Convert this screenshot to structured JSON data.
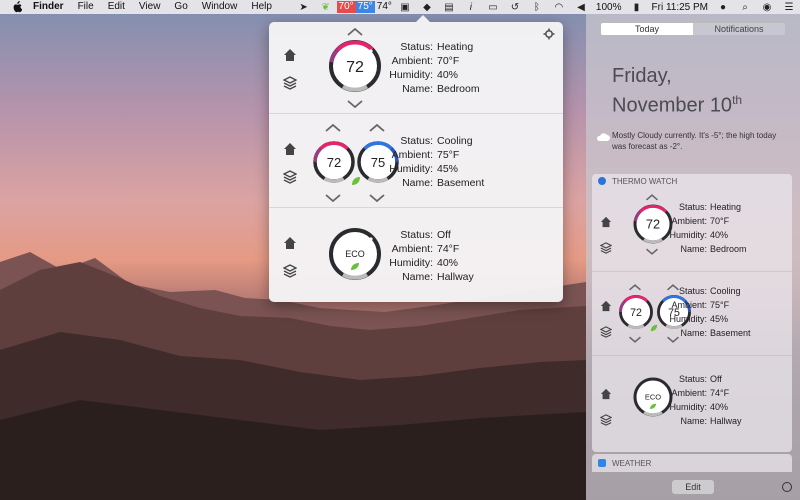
{
  "menubar": {
    "app": "Finder",
    "menus": [
      "File",
      "Edit",
      "View",
      "Go",
      "Window",
      "Help"
    ],
    "temps": [
      "70°",
      "75°",
      "74°"
    ],
    "battery": "100%",
    "clock": "Fri 11:25 PM"
  },
  "popover": {
    "rows": [
      {
        "dials": [
          "72"
        ],
        "status": "Heating",
        "ambient": "70°F",
        "humidity": "40%",
        "name": "Bedroom"
      },
      {
        "dials": [
          "72",
          "75"
        ],
        "status": "Cooling",
        "ambient": "75°F",
        "humidity": "45%",
        "name": "Basement"
      },
      {
        "dials": [
          "ECO"
        ],
        "status": "Off",
        "ambient": "74°F",
        "humidity": "40%",
        "name": "Hallway"
      }
    ],
    "labels": {
      "status": "Status:",
      "ambient": "Ambient:",
      "humidity": "Humidity:",
      "name": "Name:"
    }
  },
  "nc": {
    "tabs": [
      "Today",
      "Notifications"
    ],
    "date_line1": "Friday,",
    "date_line2": "November 10",
    "date_suffix": "th",
    "weather_text": "Mostly Cloudy currently. It's -5°; the high today was forecast as -2°.",
    "widget_title": "THERMO WATCH",
    "weather_widget_title": "WEATHER",
    "edit_label": "Edit"
  },
  "colors": {
    "heat": "#e6236f",
    "cool": "#2f76e0",
    "eco": "#6cbf3b",
    "ring": "#2b2b2f"
  }
}
